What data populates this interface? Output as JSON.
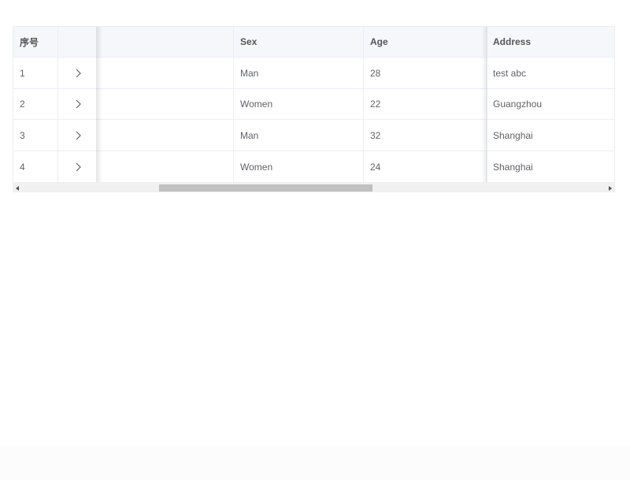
{
  "table": {
    "columns": {
      "index": "序号",
      "expand": "",
      "name": "",
      "sex": "Sex",
      "age": "Age",
      "address": "Address"
    },
    "rows": [
      {
        "index": "1",
        "sex": "Man",
        "age": "28",
        "address": "test abc"
      },
      {
        "index": "2",
        "sex": "Women",
        "age": "22",
        "address": "Guangzhou"
      },
      {
        "index": "3",
        "sex": "Man",
        "age": "32",
        "address": "Shanghai"
      },
      {
        "index": "4",
        "sex": "Women",
        "age": "24",
        "address": "Shanghai"
      }
    ]
  },
  "icons": {
    "expand": "chevron-right-icon",
    "scroll_left": "triangle-left-icon",
    "scroll_right": "triangle-right-icon"
  },
  "colors": {
    "header_bg": "#f5f7fa",
    "border": "#ebeef5",
    "text": "#606266",
    "scroll_thumb": "#c1c1c1"
  },
  "scroll": {
    "horizontal_position_fraction": 0.24
  }
}
